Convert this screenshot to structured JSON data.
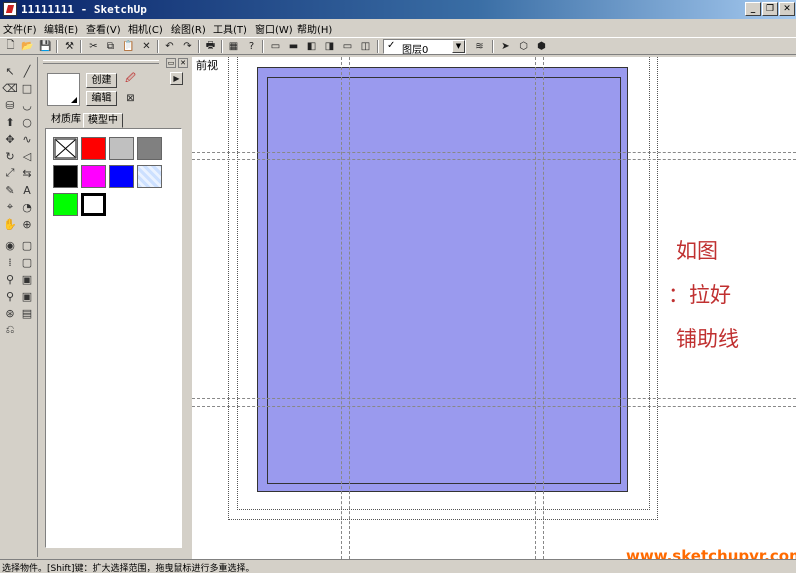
{
  "window": {
    "title": "11111111 - SketchUp",
    "controls": [
      "minimize-icon",
      "restore-icon",
      "close-icon"
    ]
  },
  "menu": [
    {
      "label": "文件(F)"
    },
    {
      "label": "编辑(E)"
    },
    {
      "label": "查看(V)"
    },
    {
      "label": "相机(C)"
    },
    {
      "label": "绘图(R)"
    },
    {
      "label": "工具(T)"
    },
    {
      "label": "窗口(W)"
    },
    {
      "label": "帮助(H)"
    }
  ],
  "toolbar": {
    "layer": {
      "checked": true,
      "value": "图层0"
    }
  },
  "materials_panel": {
    "create_label": "创建",
    "edit_label": "编辑",
    "tabs": [
      {
        "label": "材质库",
        "active": false
      },
      {
        "label": "模型中",
        "active": true
      }
    ],
    "swatches": [
      {
        "color": "#ffffff",
        "type": "default"
      },
      {
        "color": "#ff0000"
      },
      {
        "color": "#c0c0c0"
      },
      {
        "color": "#808080"
      },
      {
        "color": "#000000"
      },
      {
        "color": "#ff00ff"
      },
      {
        "color": "#0000ff"
      },
      {
        "color": "#cce0ff",
        "type": "texture"
      },
      {
        "color": "#00ff00"
      },
      {
        "color": "#ffffff",
        "type": "selected"
      }
    ]
  },
  "viewport": {
    "view_label": "前视",
    "face_color": "#9a9aee",
    "annotations": [
      "如图",
      "：拉好",
      "铺助线"
    ],
    "watermark": "www.sketchupvr.com"
  },
  "status": {
    "text": "选择物件。[Shift]键：扩大选择范围，拖曳鼠标进行多重选择。"
  }
}
